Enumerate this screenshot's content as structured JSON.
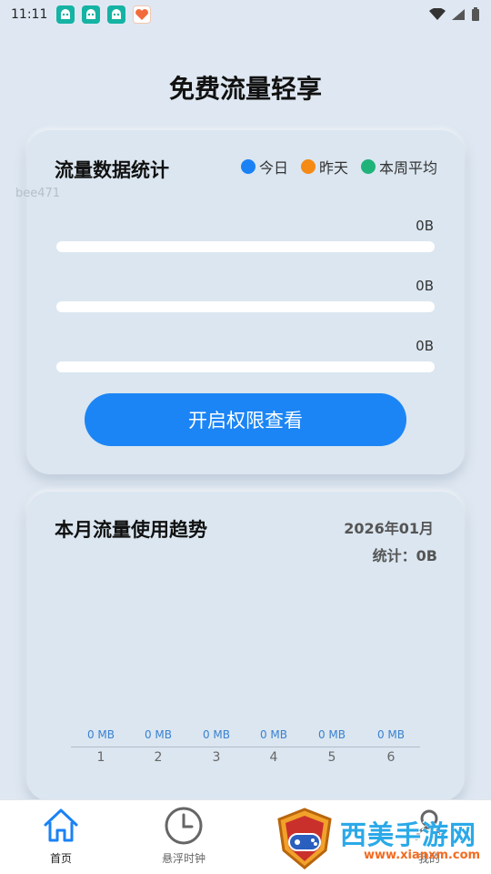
{
  "status_bar": {
    "time": "11:11"
  },
  "page": {
    "title": "免费流量轻享"
  },
  "stats_card": {
    "title": "流量数据统计",
    "legend": [
      {
        "label": "今日",
        "color": "#1a82f5"
      },
      {
        "label": "昨天",
        "color": "#f58a14"
      },
      {
        "label": "本周平均",
        "color": "#1fb37a"
      }
    ],
    "watermark": "bee471",
    "rows": [
      {
        "value": "0B",
        "progress": 0
      },
      {
        "value": "0B",
        "progress": 0
      },
      {
        "value": "0B",
        "progress": 0
      }
    ],
    "cta_label": "开启权限查看"
  },
  "trend_card": {
    "title": "本月流量使用趋势",
    "month": "2026年01月",
    "stat_label": "统计：0B",
    "days": [
      {
        "x": "1",
        "value": "0 MB"
      },
      {
        "x": "2",
        "value": "0 MB"
      },
      {
        "x": "3",
        "value": "0 MB"
      },
      {
        "x": "4",
        "value": "0 MB"
      },
      {
        "x": "5",
        "value": "0 MB"
      },
      {
        "x": "6",
        "value": "0 MB"
      }
    ]
  },
  "bottom_nav": [
    {
      "label": "首页",
      "icon": "home-icon",
      "active": true
    },
    {
      "label": "悬浮时钟",
      "icon": "clock-icon",
      "active": false
    },
    {
      "label": "",
      "icon": "tool-icon",
      "active": false
    },
    {
      "label": "我的",
      "icon": "user-icon",
      "active": false
    }
  ],
  "overlay": {
    "brand": "西美手游网",
    "url": "www.xianxm.com"
  }
}
